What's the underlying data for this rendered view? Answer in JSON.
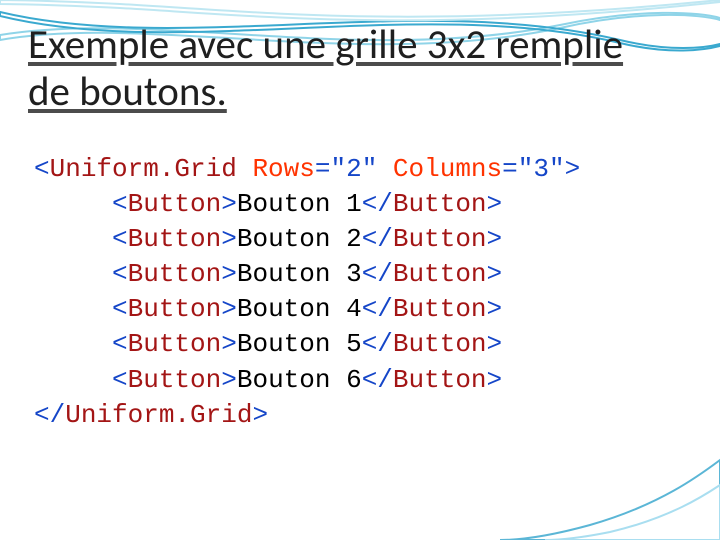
{
  "title": "Exemple avec une grille 3x2 remplie de boutons.",
  "code": {
    "open": {
      "tagL": "<",
      "tag": "Uniform.Grid",
      "sp": " ",
      "attr1": "Rows",
      "eq1": "=\"",
      "val1": "2",
      "q1": "\"",
      "sp2": " ",
      "attr2": "Columns",
      "eq2": "=\"",
      "val2": "3",
      "q2": "\">"
    },
    "btn": {
      "indent": "     ",
      "openL": "<",
      "open": "Button",
      "openR": ">",
      "labels": [
        "Bouton 1",
        "Bouton 2",
        "Bouton 3",
        "Bouton 4",
        "Bouton 5",
        "Bouton 6"
      ],
      "closeL": "</",
      "close": "Button",
      "closeR": ">"
    },
    "close": {
      "tagL": "</",
      "tag": "Uniform.Grid",
      "tagR": ">"
    }
  }
}
